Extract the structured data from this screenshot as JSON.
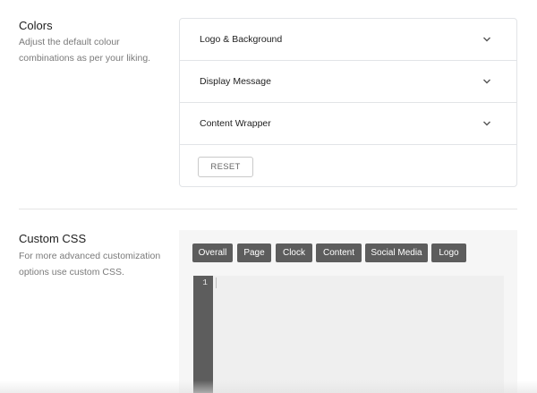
{
  "colors_section": {
    "title": "Colors",
    "description": "Adjust the default colour combinations as per your liking.",
    "accordion": [
      {
        "label": "Logo & Background"
      },
      {
        "label": "Display Message"
      },
      {
        "label": "Content Wrapper"
      }
    ],
    "reset_label": "RESET"
  },
  "custom_css_section": {
    "title": "Custom CSS",
    "description": "For more advanced customization options use custom CSS.",
    "tabs": [
      {
        "label": "Overall"
      },
      {
        "label": "Page"
      },
      {
        "label": "Clock"
      },
      {
        "label": "Content"
      },
      {
        "label": "Social Media"
      },
      {
        "label": "Logo"
      }
    ],
    "editor": {
      "line_numbers": [
        "1"
      ],
      "content": ""
    }
  },
  "icons": {
    "accordion_toggle": "chevron-down-icon"
  },
  "colors": {
    "tab_background": "#5d5d5d",
    "tab_text": "#ffffff",
    "panel_background": "#f6f6f6",
    "card_border": "#e2e4e7",
    "description_text": "#7a7a7a"
  }
}
